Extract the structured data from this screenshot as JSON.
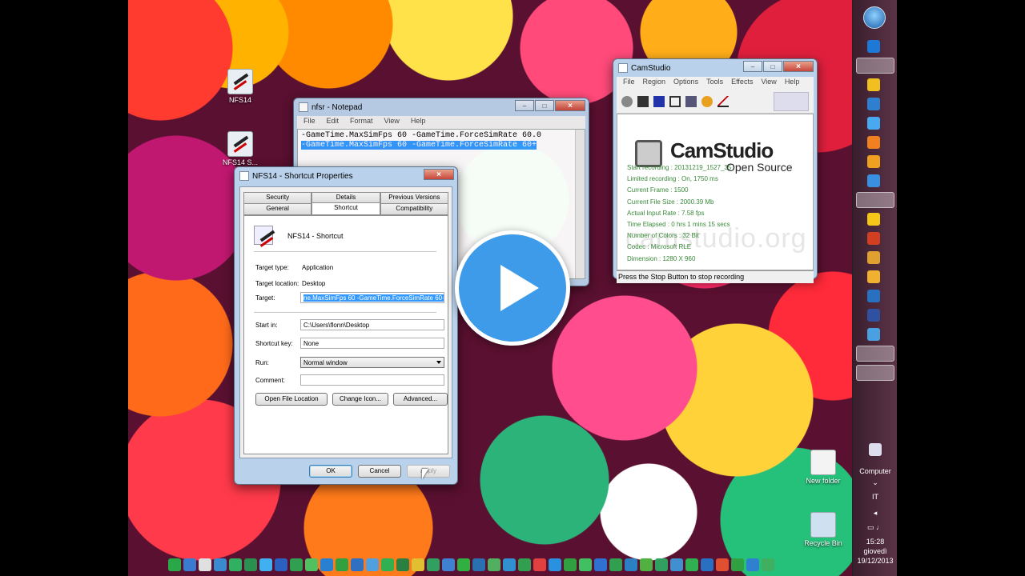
{
  "desktop": {
    "icons": [
      {
        "label": "NFS14"
      },
      {
        "label": "NFS14 S..."
      },
      {
        "label": "New folder"
      },
      {
        "label": "Recycle Bin"
      }
    ]
  },
  "notepad": {
    "title": "nfsr - Notepad",
    "menu": [
      "File",
      "Edit",
      "Format",
      "View",
      "Help"
    ],
    "lines": [
      "-GameTime.MaxSimFps 60 -GameTime.ForceSimRate 60.0",
      "-GameTime.MaxSimFps 60 -GameTime.ForceSimRate 60+"
    ]
  },
  "camstudio": {
    "title": "CamStudio",
    "menu": [
      "File",
      "Region",
      "Options",
      "Tools",
      "Effects",
      "View",
      "Help"
    ],
    "logo": "CamStudio",
    "logo_sub": "Open Source",
    "watermark": "camstudio.org",
    "stats": [
      "Start recording : 20131219_1527_35",
      "Limited recording : On, 1750 ms",
      "Current Frame : 1500",
      "Current File Size : 2000.39 Mb",
      "Actual Input Rate : 7.58 fps",
      "Time Elapsed : 0 hrs 1 mins 15 secs",
      "Number of Colors : 32 Bit",
      "Codec : Microsoft RLE",
      "Dimension : 1280 X 960"
    ],
    "status": "Press the Stop Button to stop recording"
  },
  "props": {
    "title": "NFS14 - Shortcut Properties",
    "tabs_top": [
      "Security",
      "Details",
      "Previous Versions"
    ],
    "tabs_bottom": [
      "General",
      "Shortcut",
      "Compatibility"
    ],
    "name": "NFS14 - Shortcut",
    "target_type_label": "Target type:",
    "target_type": "Application",
    "target_location_label": "Target location:",
    "target_location": "Desktop",
    "target_label": "Target:",
    "target_value": "ne.MaxSimFps 60 -GameTime.ForceSimRate 60+",
    "start_in_label": "Start in:",
    "start_in": "C:\\Users\\flonn\\Desktop",
    "shortcut_key_label": "Shortcut key:",
    "shortcut_key": "None",
    "run_label": "Run:",
    "run_value": "Normal window",
    "comment_label": "Comment:",
    "comment": "",
    "btn_open": "Open File Location",
    "btn_change": "Change Icon...",
    "btn_advanced": "Advanced...",
    "btn_ok": "OK",
    "btn_cancel": "Cancel",
    "btn_apply": "Apply"
  },
  "tray": {
    "computer": "Computer",
    "lang": "IT",
    "time": "15:28",
    "day": "giovedì",
    "date": "19/12/2013"
  },
  "colors": {
    "accent": "#3d9be9",
    "selection": "#3399ff"
  }
}
